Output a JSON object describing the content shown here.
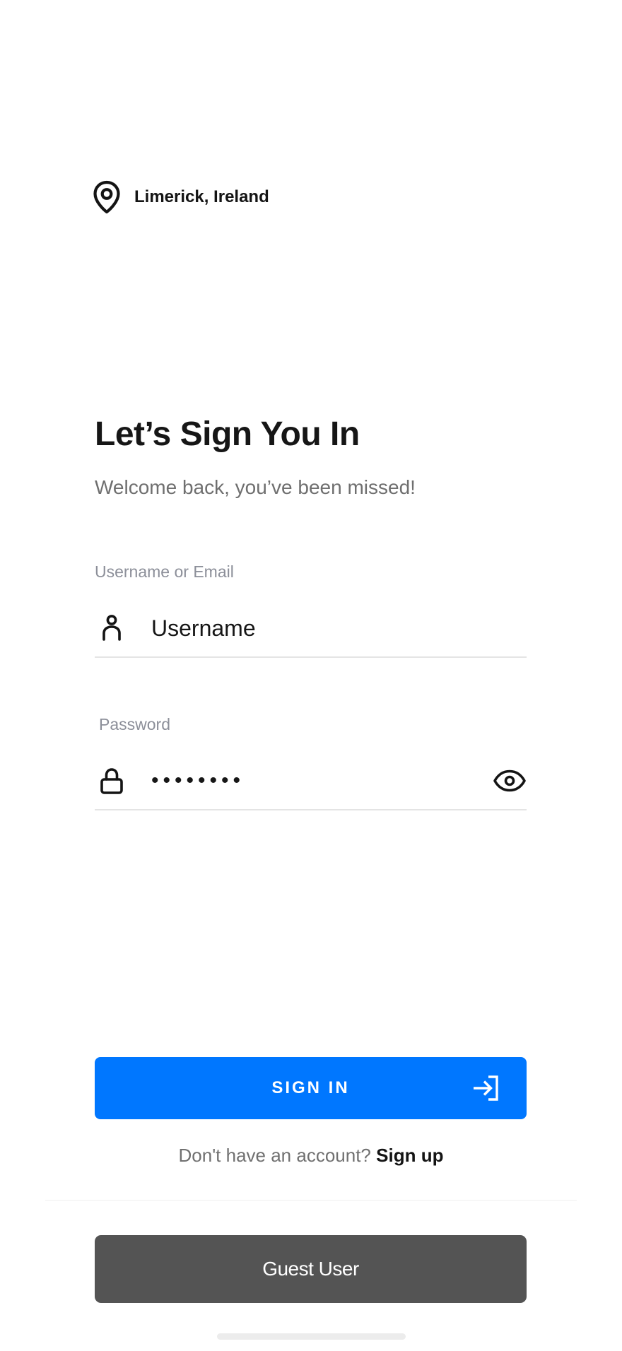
{
  "location": {
    "icon": "map-pin-icon",
    "text": "Limerick, Ireland"
  },
  "header": {
    "title": "Let’s Sign You In",
    "subtitle": "Welcome back, you’ve been missed!"
  },
  "username_field": {
    "label": "Username or Email",
    "icon": "user-icon",
    "placeholder": "Username",
    "value": ""
  },
  "password_field": {
    "label": "Password",
    "icon": "lock-icon",
    "masked_value": "••••••••",
    "toggle_icon": "eye-icon"
  },
  "signin_button": {
    "label": "SIGN IN",
    "icon": "arrow-right-to-bracket-icon"
  },
  "signup_prompt": {
    "text": "Don't have an account?",
    "link": "Sign up"
  },
  "guest_button": {
    "label": "Guest User"
  },
  "colors": {
    "primary": "#0077ff",
    "guest_button": "#545454",
    "text_dark": "#141414",
    "text_muted": "#6f6f6f",
    "label_gray": "#8c8f99",
    "background": "#ffffff"
  }
}
